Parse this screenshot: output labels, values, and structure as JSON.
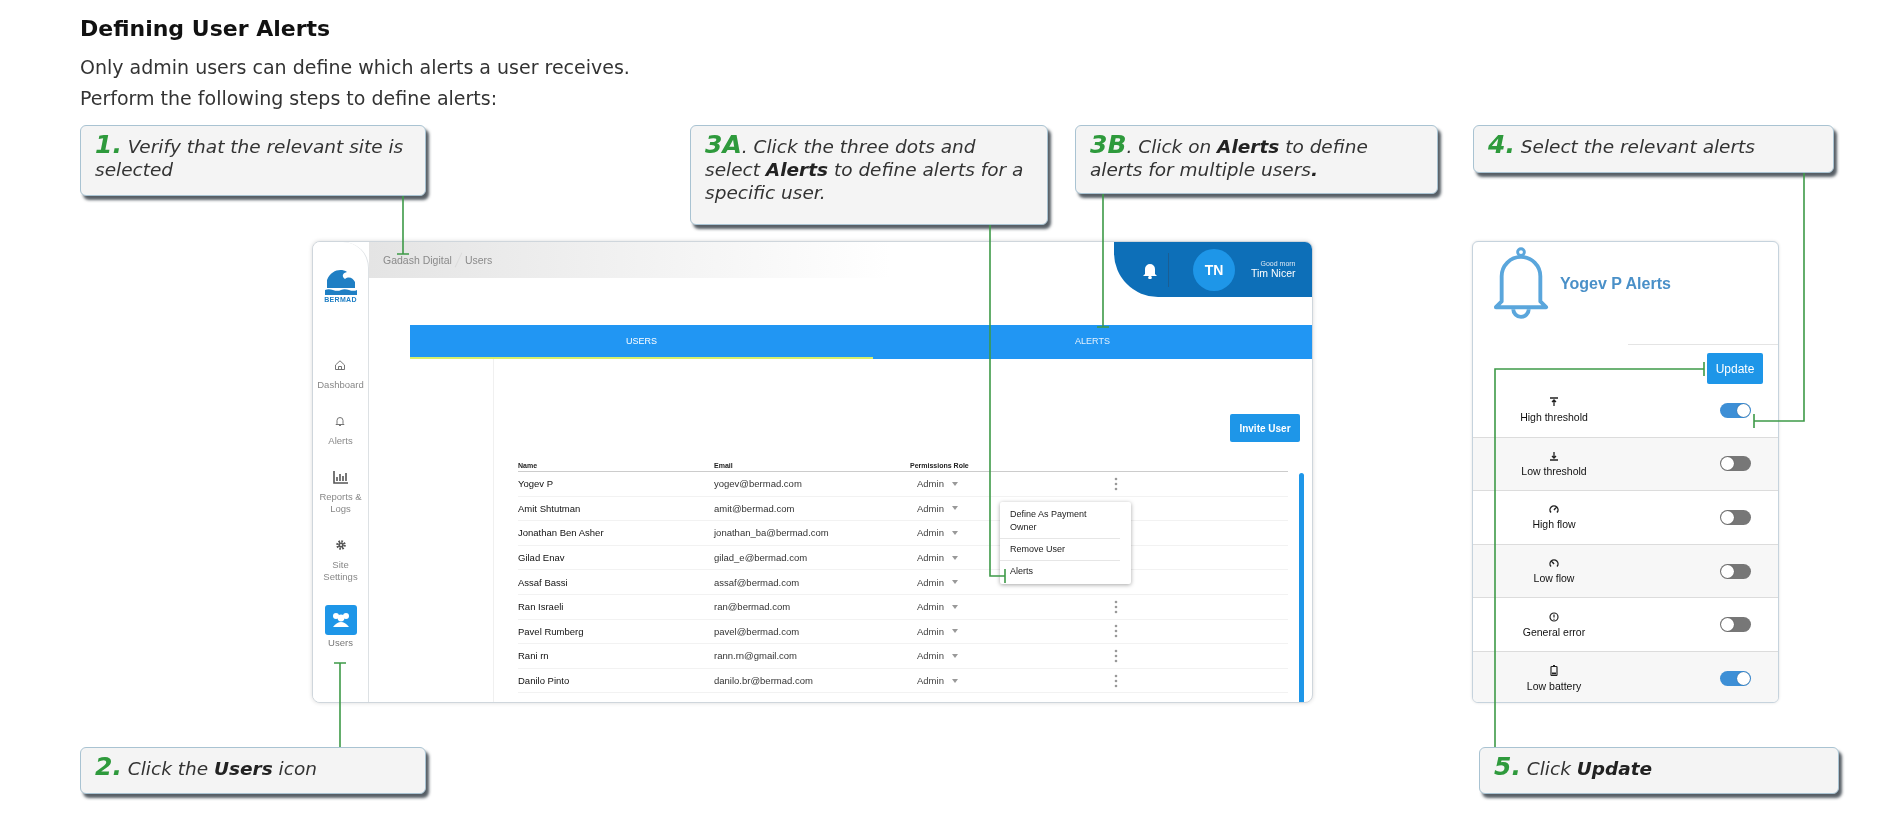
{
  "heading": "Defining User Alerts",
  "intro": [
    "Only admin users can define which alerts a user receives.",
    "Perform the following steps to define alerts:"
  ],
  "callouts": [
    {
      "step": "1.",
      "text": " Verify that the relevant site is selected"
    },
    {
      "step": "3A",
      "text": ". Click the three dots and select **Alerts** to define alerts for a specific user."
    },
    {
      "step": "3B",
      "text": ". Click on **Alerts** to define alerts for multiple users**.**"
    },
    {
      "step": "4.",
      "text": " Select the relevant alerts"
    },
    {
      "step": "2.",
      "text": " Click the **Users** icon"
    },
    {
      "step": "5.",
      "text": " Click **Update**"
    }
  ],
  "app": {
    "logo": "BERMAD",
    "breadcrumb": [
      "Gadash Digital",
      "Users"
    ],
    "avatar_initials": "TN",
    "greeting": "Good morn",
    "user_name": "Tim Nicer",
    "sidebar": [
      {
        "label": "Dashboard",
        "selected": false
      },
      {
        "label": "Alerts",
        "selected": false
      },
      {
        "label": "Reports & Logs",
        "selected": false
      },
      {
        "label": "Site Settings",
        "selected": false
      },
      {
        "label": "Users",
        "selected": true
      }
    ],
    "tabs": [
      {
        "label": "USERS",
        "selected": true
      },
      {
        "label": "ALERTS",
        "selected": false
      }
    ],
    "invite_button": "Invite User",
    "table": {
      "columns": [
        "Name",
        "Email",
        "Permissions Role"
      ],
      "rows": [
        {
          "name": "Yogev P",
          "email": "yogev@bermad.com",
          "role": "Admin"
        },
        {
          "name": "Amit Shtutman",
          "email": "amit@bermad.com",
          "role": "Admin"
        },
        {
          "name": "Jonathan Ben Asher",
          "email": "jonathan_ba@bermad.com",
          "role": "Admin"
        },
        {
          "name": "Gilad Enav",
          "email": "gilad_e@bermad.com",
          "role": "Admin"
        },
        {
          "name": "Assaf Bassi",
          "email": "assaf@bermad.com",
          "role": "Admin"
        },
        {
          "name": "Ran Israeli",
          "email": "ran@bermad.com",
          "role": "Admin"
        },
        {
          "name": "Pavel Rumberg",
          "email": "pavel@bermad.com",
          "role": "Admin"
        },
        {
          "name": "Rani rn",
          "email": "rann.rn@gmail.com",
          "role": "Admin"
        },
        {
          "name": "Danilo Pinto",
          "email": "danilo.br@bermad.com",
          "role": "Admin"
        }
      ]
    },
    "context_menu": [
      "Define As Payment Owner",
      "Remove User",
      "Alerts"
    ]
  },
  "alerts_panel": {
    "title": "Yogev P Alerts",
    "update_button": "Update",
    "alerts": [
      {
        "label": "High threshold",
        "on": true
      },
      {
        "label": "Low threshold",
        "on": false
      },
      {
        "label": "High flow",
        "on": false
      },
      {
        "label": "Low flow",
        "on": false
      },
      {
        "label": "General error",
        "on": false
      },
      {
        "label": "Low battery",
        "on": true
      }
    ]
  }
}
